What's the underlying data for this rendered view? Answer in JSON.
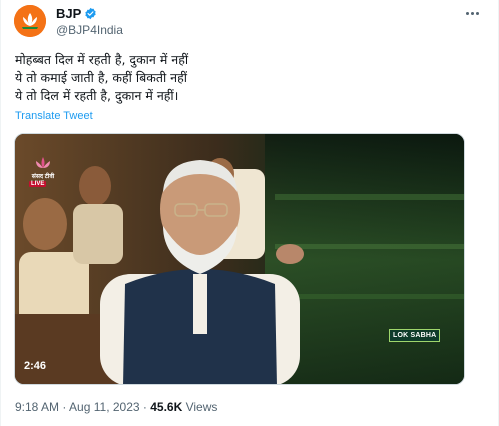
{
  "author": {
    "display_name": "BJP",
    "handle": "@BJP4India",
    "verified_icon": "verified-badge-icon",
    "avatar_icon": "lotus-logo-icon",
    "colors": {
      "avatar_bg": "#f47216",
      "verified": "#1d9bf0"
    }
  },
  "tweet": {
    "lines": [
      "मोहब्बत दिल में रहती है, दुकान में नहीं",
      "ये तो कमाई जाती है, कहीं बिकती नहीं",
      "ये तो दिल में रहती है, दुकान में नहीं।"
    ],
    "translate_label": "Translate Tweet"
  },
  "media": {
    "type": "video",
    "channel_name": "संसद टीवी",
    "live_label": "LIVE",
    "overlay_label": "LOK SABHA",
    "duration": "2:46"
  },
  "meta": {
    "time": "9:18 AM",
    "separator": " · ",
    "date": "Aug 11, 2023",
    "views_count": "45.6K",
    "views_label": " Views"
  },
  "colors": {
    "link": "#1d9bf0",
    "secondary_text": "#536471",
    "primary_text": "#0f1419"
  }
}
